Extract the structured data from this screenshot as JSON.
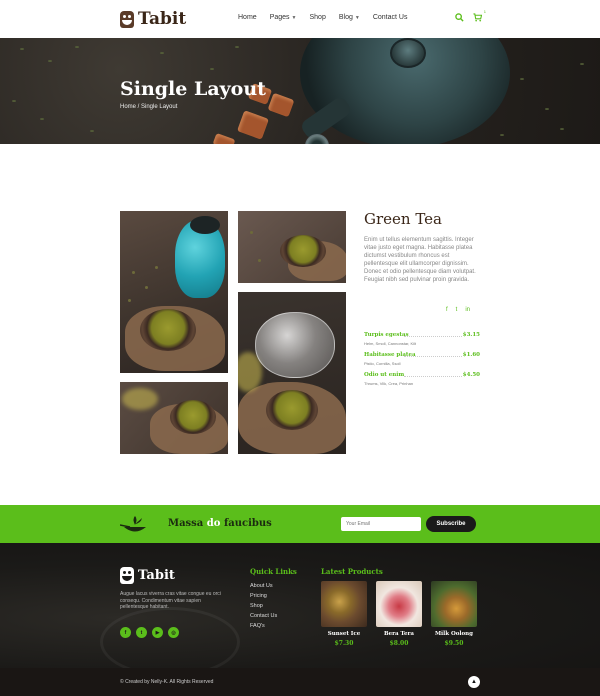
{
  "header": {
    "logo_text": "Tabit",
    "nav": [
      {
        "label": "Home",
        "dropdown": false
      },
      {
        "label": "Pages",
        "dropdown": true
      },
      {
        "label": "Shop",
        "dropdown": false
      },
      {
        "label": "Blog",
        "dropdown": true
      },
      {
        "label": "Contact Us",
        "dropdown": false
      }
    ],
    "cart_count": "1",
    "accent_color": "#5bbe1b"
  },
  "hero": {
    "title": "Single Layout",
    "breadcrumb": "Home / Single Layout"
  },
  "product": {
    "title": "Green Tea",
    "description": "Enim ut tellus elementum sagittis. Integer vitae justo eget magna. Habitasse platea dictumst vestibulum rhoncus est pellentesque elit ullamcorper dignissim. Donec et odio pellentesque diam volutpat. Feugiat nibh sed pulvinar proin gravida.",
    "share_icons": [
      "facebook-icon",
      "twitter-icon",
      "linkedin-icon"
    ],
    "prices": [
      {
        "name": "Turpis egestas",
        "price": "$3.15",
        "ingredients": "Helm, Smoll, Cannonstar, Kilt"
      },
      {
        "name": "Habitasse platea",
        "price": "$1.60",
        "ingredients": "Pistio, Cornilla, Ssoll"
      },
      {
        "name": "Odio ut enim",
        "price": "$4.50",
        "ingredients": "Thrums, Vilk, Crea, Prinhan"
      }
    ]
  },
  "newsletter": {
    "title_before": "Massa",
    "title_highlight": "do",
    "title_after": "faucibus",
    "email_placeholder": "Your Email",
    "button_label": "Subscribe"
  },
  "footer": {
    "logo_text": "Tabit",
    "about": "Augue lacus viverra cras vitae congue eu orci consequ. Condimentum vitae sapien pellentesque habitant.",
    "social_icons": [
      "facebook-icon",
      "twitter-icon",
      "youtube-icon",
      "instagram-icon"
    ],
    "quick_links_title": "Quick Links",
    "quick_links": [
      "About Us",
      "Pricing",
      "Shop",
      "Contact Us",
      "FAQ's"
    ],
    "latest_title": "Latest Products",
    "products": [
      {
        "name": "Sunset Ice",
        "price": "$7.30"
      },
      {
        "name": "Bera Tera",
        "price": "$8.00"
      },
      {
        "name": "Milk Oolong",
        "price": "$9.50"
      }
    ],
    "copyright": "© Created by Nelly-K. All Rights Reserved"
  }
}
